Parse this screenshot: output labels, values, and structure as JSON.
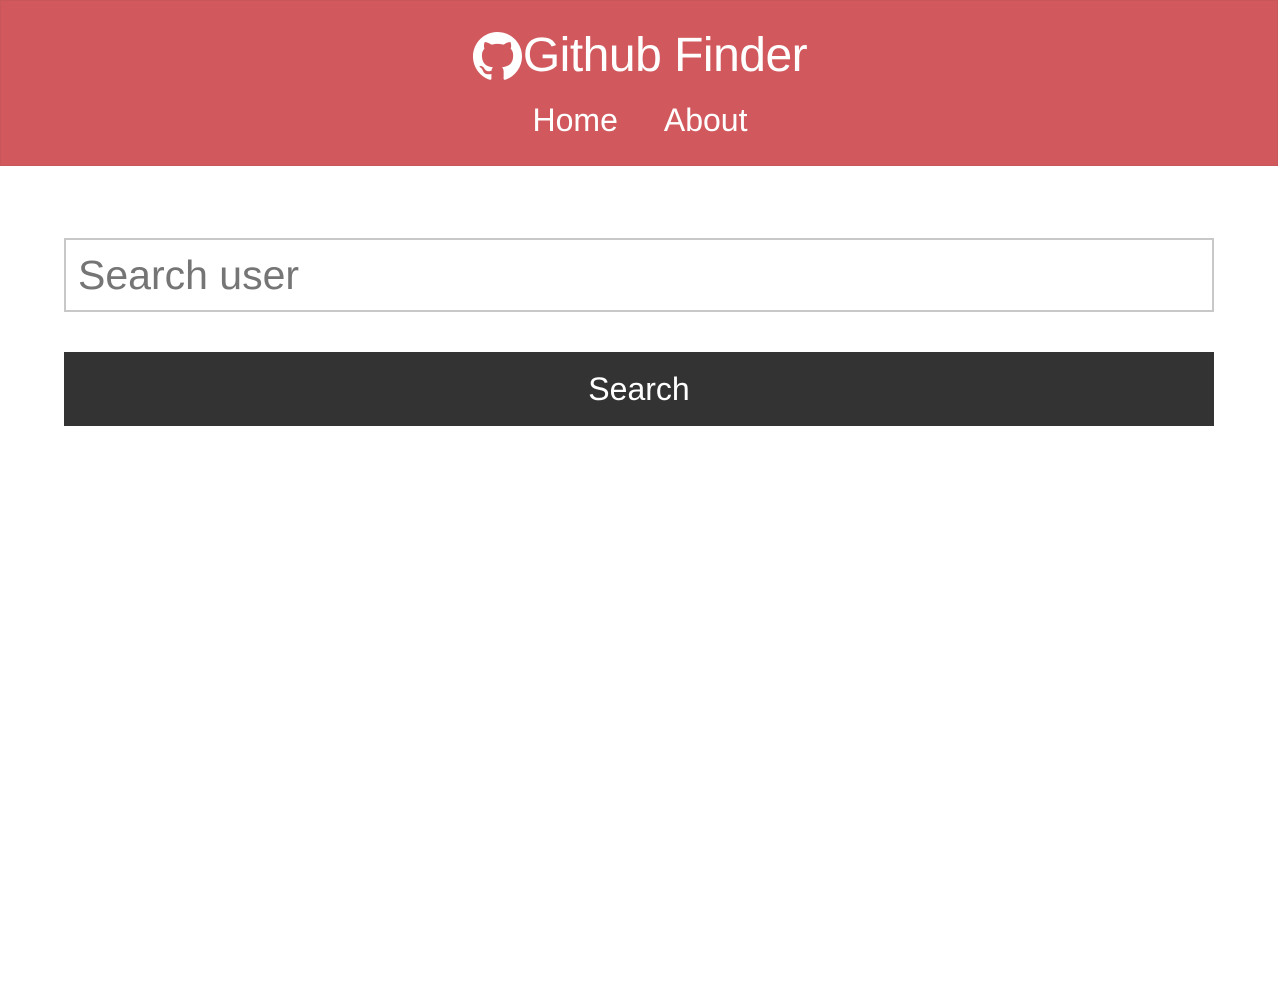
{
  "navbar": {
    "title": "Github Finder",
    "icon": "github-icon",
    "background_color": "#d1595d",
    "links": [
      {
        "label": "Home"
      },
      {
        "label": "About"
      }
    ]
  },
  "search": {
    "placeholder": "Search user",
    "value": "",
    "button_label": "Search",
    "button_color": "#333333"
  }
}
